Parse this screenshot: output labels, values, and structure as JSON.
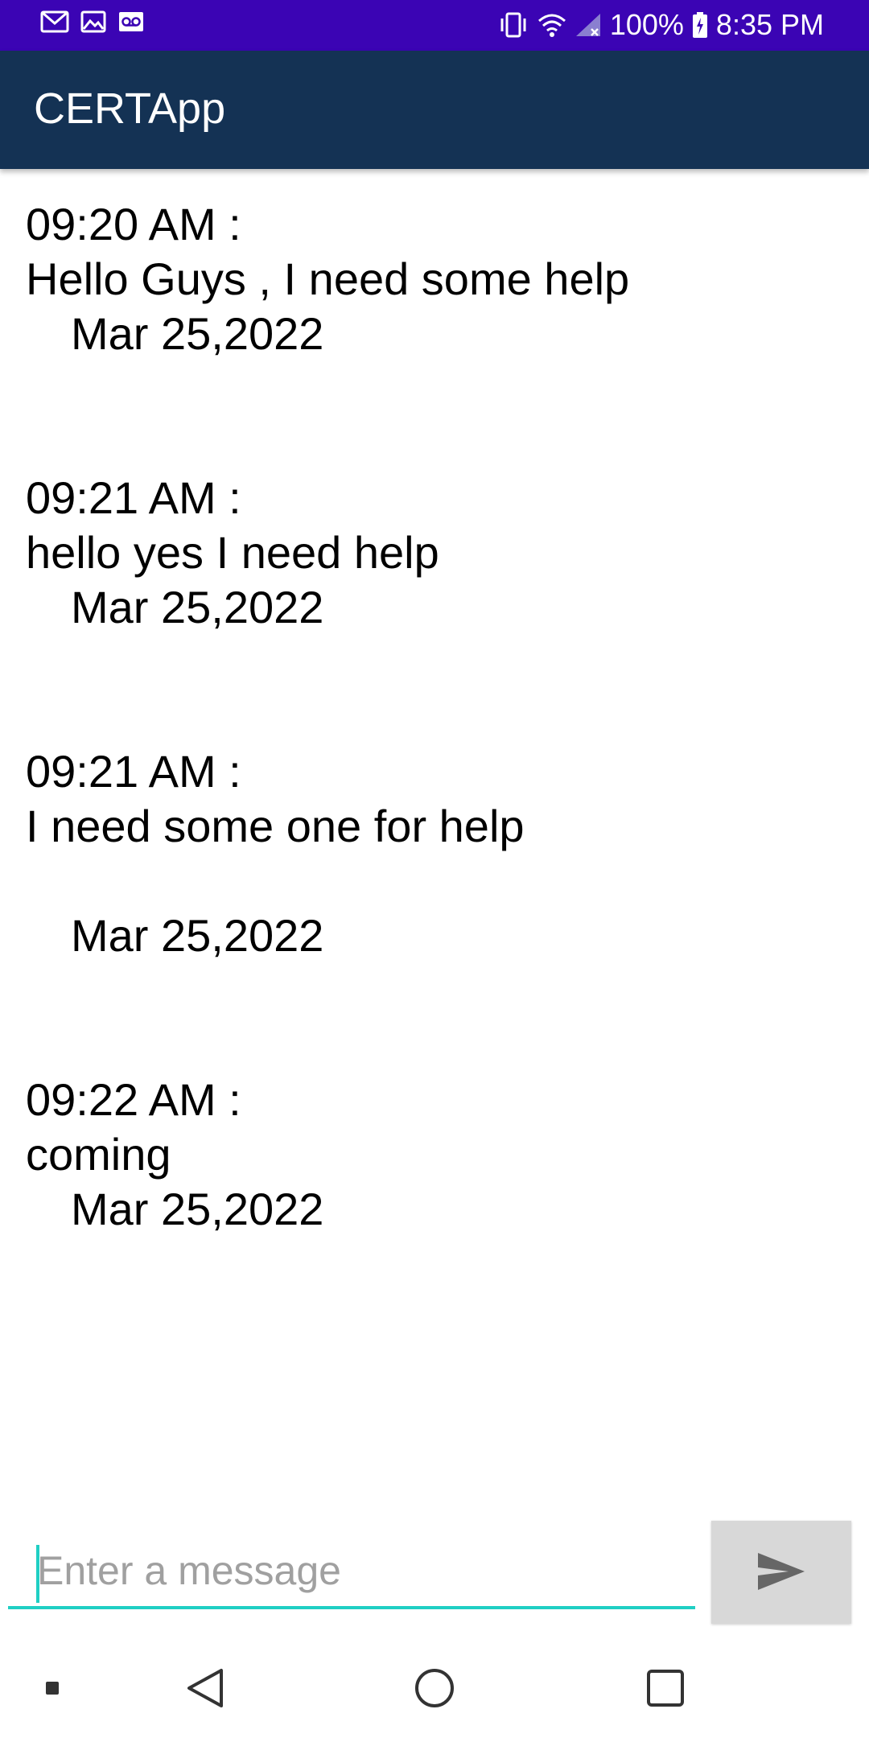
{
  "status_bar": {
    "icons_left": [
      "gmail-icon",
      "image-icon",
      "voicemail-icon"
    ],
    "icons_right": [
      "vibrate-icon",
      "wifi-icon",
      "signal-icon",
      "battery-icon"
    ],
    "battery": "100%",
    "time": "8:35 PM"
  },
  "app_bar": {
    "title": "CERTApp"
  },
  "messages": [
    {
      "time": "09:20 AM :",
      "text": "Hello Guys , I need some help",
      "date": "Mar 25,2022"
    },
    {
      "time": "09:21 AM :",
      "text": "hello yes I need help",
      "date": "Mar 25,2022"
    },
    {
      "time": "09:21 AM :",
      "text": "I need some one for help",
      "date": "Mar 25,2022"
    },
    {
      "time": "09:22 AM :",
      "text": "coming",
      "date": "Mar 25,2022"
    }
  ],
  "input": {
    "value": "",
    "placeholder": "Enter a message"
  },
  "send_button": {
    "icon": "send-icon"
  },
  "nav_bar": {
    "icons": [
      "menu-dot-icon",
      "back-icon",
      "home-icon",
      "recents-icon"
    ]
  },
  "colors": {
    "status_bar": "#3b04b4",
    "app_bar": "#143254",
    "accent": "#1fcfc4",
    "send_bg": "#d8d8d8"
  }
}
